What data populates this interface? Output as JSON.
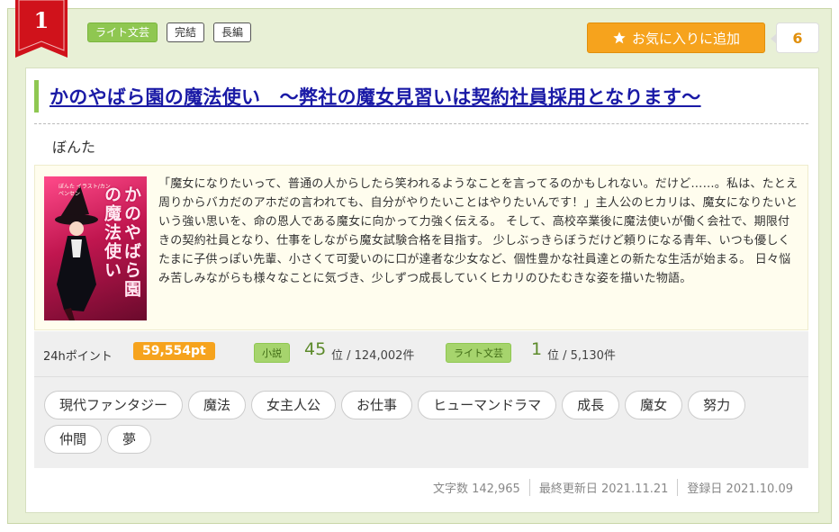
{
  "rank": "1",
  "top_tags": [
    "ライト文芸",
    "完結",
    "長編"
  ],
  "favorite": {
    "label": "お気に入りに追加",
    "count": "6"
  },
  "title": "かのやばら園の魔法使い　～弊社の魔女見習いは契約社員採用となります～",
  "author": "ぼんた",
  "cover": {
    "title": "かのやばら園の魔法使い",
    "author_text": "ぼんた イラスト/カンペンセン"
  },
  "synopsis": "「魔女になりたいって、普通の人からしたら笑われるようなことを言ってるのかもしれない。だけど……。私は、たとえ周りからバカだのアホだの言われても、自分がやりたいことはやりたいんです！」主人公のヒカリは、魔女になりたいという強い思いを、命の恩人である魔女に向かって力強く伝える。 そして、高校卒業後に魔法使いが働く会社で、期限付きの契約社員となり、仕事をしながら魔女試験合格を目指す。 少しぶっきらぼうだけど頼りになる青年、いつも優しくたまに子供っぽい先輩、小さくて可愛いのに口が達者な少女など、個性豊かな社員達との新たな生活が始まる。 日々悩み苦しみながらも様々なことに気づき、少しずつ成長していくヒカリのひたむきな姿を描いた物語。",
  "stats": {
    "points_label": "24hポイント",
    "points_value": "59,554pt",
    "novel_tag": "小説",
    "novel_rank": "45",
    "novel_total": "位 / 124,002件",
    "genre_tag": "ライト文芸",
    "genre_rank": "1",
    "genre_total": "位 / 5,130件"
  },
  "keywords": [
    "現代ファンタジー",
    "魔法",
    "女主人公",
    "お仕事",
    "ヒューマンドラマ",
    "成長",
    "魔女",
    "努力",
    "仲間",
    "夢"
  ],
  "meta": {
    "chars": "文字数 142,965",
    "updated": "最終更新日 2021.11.21",
    "registered": "登録日 2021.10.09"
  },
  "colors": {
    "accent_green": "#8fc751",
    "accent_orange": "#f6a31d",
    "title_blue": "#1a1aa6",
    "badge_red": "#d0121b"
  },
  "icons": {
    "favorite": "star-icon"
  }
}
